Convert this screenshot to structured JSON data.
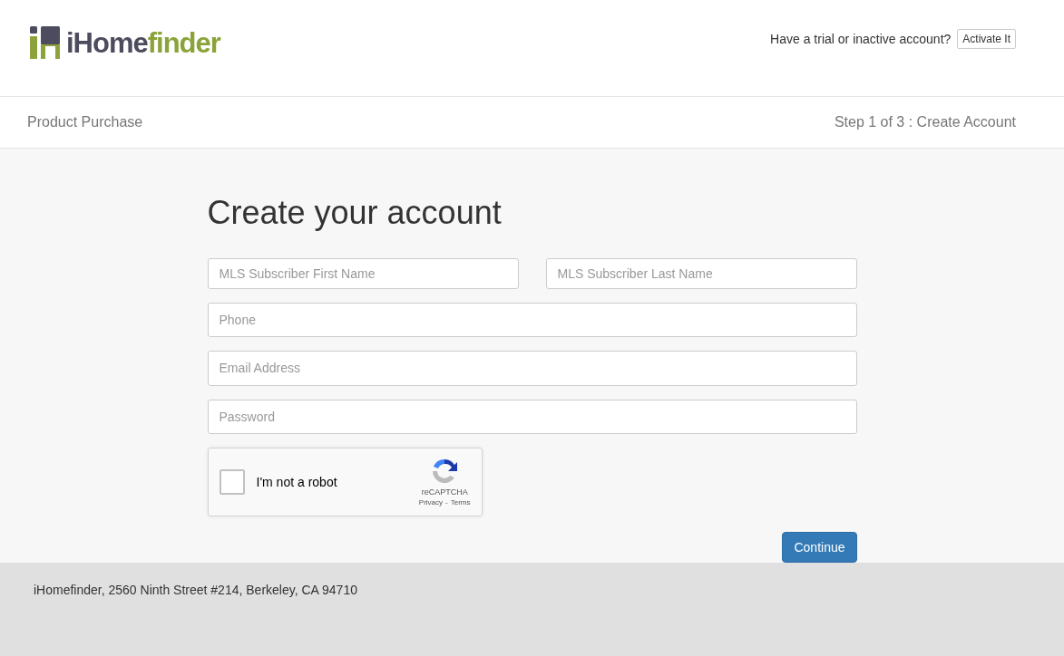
{
  "header": {
    "logo": {
      "part_1": "iHome",
      "part_2": "finder"
    },
    "trial_prompt": "Have a trial or inactive account?",
    "activate_button": "Activate It"
  },
  "nav": {
    "title": "Product Purchase",
    "step": "Step 1 of 3 : Create Account"
  },
  "form": {
    "heading": "Create your account",
    "name_fields": [
      {
        "placeholder": "MLS Subscriber First Name"
      },
      {
        "placeholder": "MLS Subscriber Last Name"
      }
    ],
    "fields": [
      {
        "placeholder": "Phone"
      },
      {
        "placeholder": "Email Address"
      },
      {
        "placeholder": "Password"
      }
    ],
    "captcha": {
      "label": "I'm not a robot",
      "checked": false,
      "brand": "reCAPTCHA",
      "privacy": "Privacy",
      "separator": "-",
      "terms": "Terms"
    },
    "continue_button": "Continue"
  },
  "footer": {
    "address": "iHomefinder, 2560 Ninth Street #214, Berkeley, CA 94710"
  }
}
